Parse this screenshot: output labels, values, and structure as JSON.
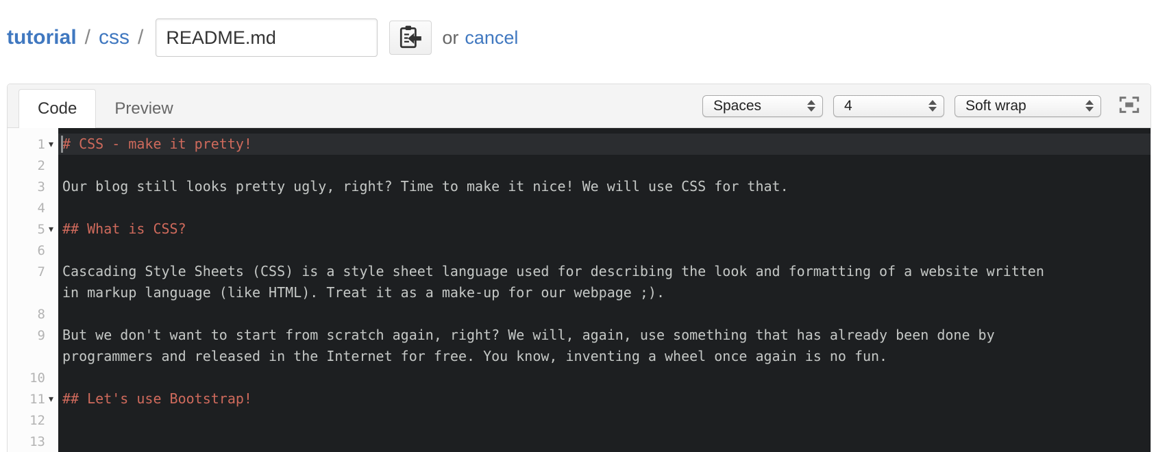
{
  "colors": {
    "link_blue": "#4078c0",
    "header_bg": "#f4f4f4",
    "border": "#dddddd",
    "editor_bg": "#1d1f21",
    "editor_active_line": "#2b2d30",
    "editor_text": "#c5c8c6",
    "heading_red": "#cf6a5c",
    "gutter_bg": "#fcfcfc",
    "gutter_num": "#b3b3b3"
  },
  "breadcrumb": {
    "repo": "tutorial",
    "separator": "/",
    "dir": "css",
    "filename_value": "README.md",
    "or_text": "or",
    "cancel_label": "cancel"
  },
  "tabs": {
    "code": "Code",
    "preview": "Preview"
  },
  "toolbar": {
    "indent_mode": "Spaces",
    "indent_size": "4",
    "wrap_mode": "Soft wrap"
  },
  "icons": {
    "fold_glyph": "▾",
    "template_button_icon": "clipboard-with-arrow",
    "fullscreen_icon": "screen-full"
  },
  "editor": {
    "rows": [
      {
        "num": "1",
        "fold": true,
        "type": "heading",
        "active": true,
        "cursor": true,
        "text": "# CSS - make it pretty!"
      },
      {
        "num": "2",
        "text": ""
      },
      {
        "num": "3",
        "type": "text",
        "text": "Our blog still looks pretty ugly, right? Time to make it nice! We will use CSS for that."
      },
      {
        "num": "4",
        "text": ""
      },
      {
        "num": "5",
        "fold": true,
        "type": "heading",
        "text": "## What is CSS?"
      },
      {
        "num": "6",
        "text": ""
      },
      {
        "num": "7",
        "type": "text",
        "text": "Cascading Style Sheets (CSS) is a style sheet language used for describing the look and formatting of a website written"
      },
      {
        "num": "",
        "type": "text",
        "text": "in markup language (like HTML). Treat it as a make-up for our webpage ;)."
      },
      {
        "num": "8",
        "text": ""
      },
      {
        "num": "9",
        "type": "text",
        "text": "But we don't want to start from scratch again, right? We will, again, use something that has already been done by"
      },
      {
        "num": "",
        "type": "text",
        "text": "programmers and released in the Internet for free. You know, inventing a wheel once again is no fun."
      },
      {
        "num": "10",
        "text": ""
      },
      {
        "num": "11",
        "fold": true,
        "type": "heading",
        "text": "## Let's use Bootstrap!"
      },
      {
        "num": "12",
        "text": ""
      },
      {
        "num": "13",
        "text": ""
      }
    ]
  }
}
